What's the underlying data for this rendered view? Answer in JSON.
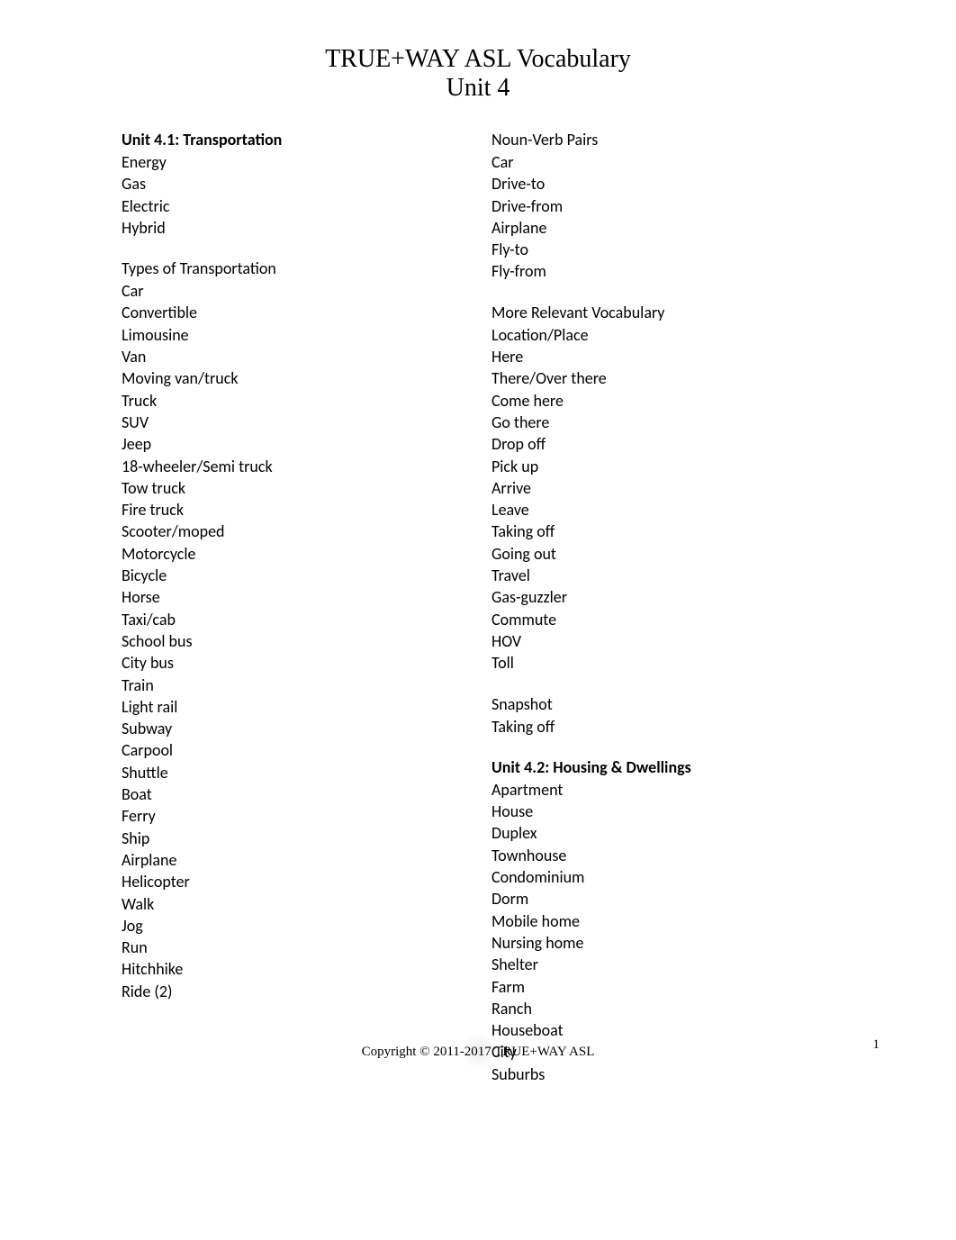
{
  "header": {
    "title": "TRUE+WAY ASL Vocabulary",
    "subtitle": "Unit 4"
  },
  "left": {
    "section1_heading": "Unit 4.1: Transportation",
    "energy_items": [
      "Energy",
      "Gas",
      "Electric",
      "Hybrid"
    ],
    "types_heading": "Types of Transportation",
    "types_items": [
      "Car",
      "Convertible",
      "Limousine",
      "Van",
      "Moving van/truck",
      "Truck",
      "SUV",
      "Jeep",
      "18-wheeler/Semi truck",
      "Tow truck",
      "Fire truck",
      "Scooter/moped",
      "Motorcycle",
      "Bicycle",
      "Horse",
      "Taxi/cab",
      "School bus",
      "City bus",
      "Train",
      "Light rail",
      "Subway",
      "Carpool",
      "Shuttle",
      "Boat",
      "Ferry",
      "Ship",
      "Airplane",
      "Helicopter",
      "Walk",
      "Jog",
      "Run",
      "Hitchhike",
      "Ride (2)"
    ]
  },
  "right": {
    "noun_verb_heading": "Noun-Verb Pairs",
    "noun_verb_items": [
      "Car",
      "Drive-to",
      "Drive-from",
      "Airplane",
      "Fly-to",
      "Fly-from"
    ],
    "more_heading": "More Relevant Vocabulary",
    "more_items": [
      "Location/Place",
      "Here",
      "There/Over there",
      "Come here",
      "Go there",
      "Drop off",
      "Pick up",
      "Arrive",
      "Leave",
      "Taking off",
      "Going out",
      "Travel",
      "Gas-guzzler",
      "Commute",
      "HOV",
      "Toll"
    ],
    "snapshot_heading": "Snapshot",
    "snapshot_items": [
      "Taking off"
    ],
    "section2_heading": "Unit 4.2: Housing & Dwellings",
    "section2_items": [
      "Apartment",
      "House",
      "Duplex",
      "Townhouse",
      "Condominium",
      "Dorm",
      "Mobile home",
      "Nursing home",
      "Shelter",
      "Farm",
      "Ranch",
      "Houseboat",
      "City",
      "Suburbs"
    ]
  },
  "footer": {
    "copyright": "Copyright © 2011-2017 TRUE+WAY ASL",
    "page_number": "1"
  }
}
